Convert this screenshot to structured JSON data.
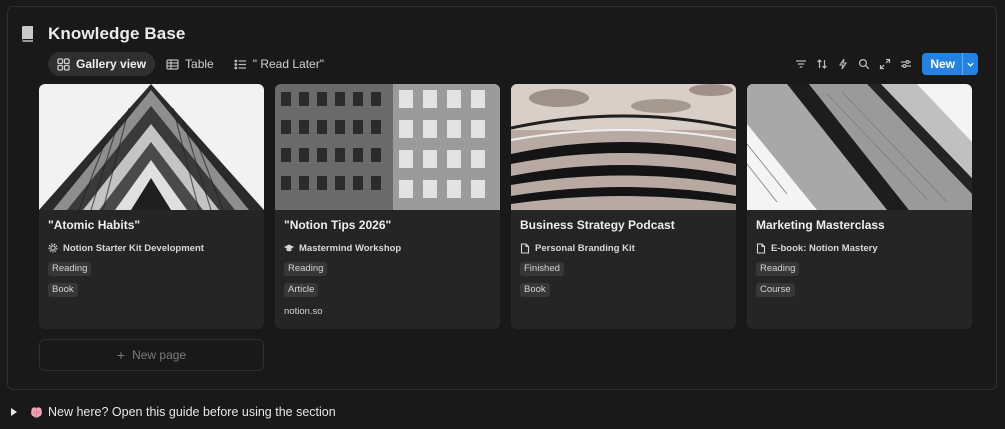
{
  "database": {
    "title": "Knowledge Base",
    "icon": "book-icon"
  },
  "views": [
    {
      "label": "Gallery view",
      "icon": "gallery-grid-icon",
      "active": true
    },
    {
      "label": "Table",
      "icon": "table-icon",
      "active": false
    },
    {
      "label": "\" Read Later\"",
      "icon": "list-icon",
      "active": false
    }
  ],
  "toolbar": {
    "icons": [
      "filter-icon",
      "sort-icon",
      "automation-bolt-icon",
      "search-icon",
      "expand-icon",
      "settings-sliders-icon"
    ],
    "new_label": "New"
  },
  "cards": [
    {
      "title": "\"Atomic Habits\"",
      "related": "Notion Starter Kit Development",
      "related_icon": "gear-icon",
      "status": "Reading",
      "type": "Book",
      "url": ""
    },
    {
      "title": "\"Notion Tips 2026\"",
      "related": "Mastermind Workshop",
      "related_icon": "graduation-cap-icon",
      "status": "Reading",
      "type": "Article",
      "url": "notion.so"
    },
    {
      "title": "Business Strategy Podcast",
      "related": "Personal Branding Kit",
      "related_icon": "page-icon",
      "status": "Finished",
      "type": "Book",
      "url": ""
    },
    {
      "title": "Marketing Masterclass",
      "related": "E-book: Notion Mastery",
      "related_icon": "page-icon",
      "status": "Reading",
      "type": "Course",
      "url": ""
    }
  ],
  "new_page_label": "New page",
  "toggle": {
    "label": "New here? Open this guide before using the section",
    "icon": "brain-icon"
  },
  "colors": {
    "background": "#191919",
    "card": "#252525",
    "accent": "#2383e2",
    "tag": "#373737"
  }
}
